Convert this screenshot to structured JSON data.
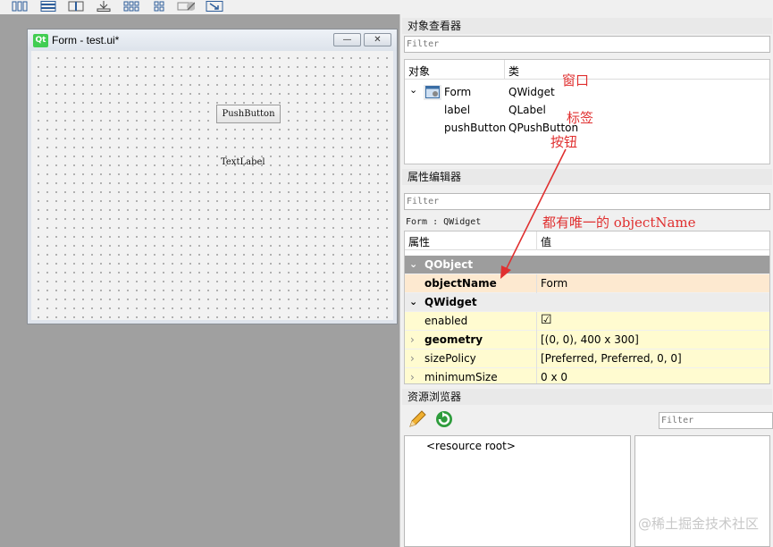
{
  "form_window": {
    "logo": "Qt",
    "title": "Form - test.ui*",
    "minimize_glyph": "—",
    "close_glyph": "✕",
    "push_button_label": "PushButton",
    "text_label": "TextLabel"
  },
  "object_inspector": {
    "title": "对象查看器",
    "filter_placeholder": "Filter",
    "columns": [
      "对象",
      "类"
    ],
    "rows": [
      {
        "object": "Form",
        "class": "QWidget"
      },
      {
        "object": "label",
        "class": "QLabel"
      },
      {
        "object": "pushButton",
        "class": "QPushButton"
      }
    ]
  },
  "property_editor": {
    "title": "属性编辑器",
    "filter_placeholder": "Filter",
    "context": "Form : QWidget",
    "columns": [
      "属性",
      "值"
    ],
    "groups": [
      {
        "name": "QObject"
      },
      {
        "name": "QWidget"
      }
    ],
    "props": [
      {
        "name": "objectName",
        "value": "Form"
      },
      {
        "name": "enabled",
        "value": "☑"
      },
      {
        "name": "geometry",
        "value": "[(0, 0), 400 x 300]"
      },
      {
        "name": "sizePolicy",
        "value": "[Preferred, Preferred, 0, 0]"
      },
      {
        "name": "minimumSize",
        "value": "0 x 0"
      }
    ]
  },
  "resource_browser": {
    "title": "资源浏览器",
    "filter_placeholder": "Filter",
    "root": "<resource root>"
  },
  "annotations": {
    "window": "窗口",
    "label": "标签",
    "button": "按钮",
    "object_name_note": "都有唯一的 objectName"
  },
  "watermark": "@稀土掘金技术社区",
  "colors": {
    "annotation": "#e03030",
    "group_header": "#9d9d9d",
    "qt_green": "#41cd52",
    "selected_row": "#fde9d0",
    "property_row": "#fffbd0"
  }
}
